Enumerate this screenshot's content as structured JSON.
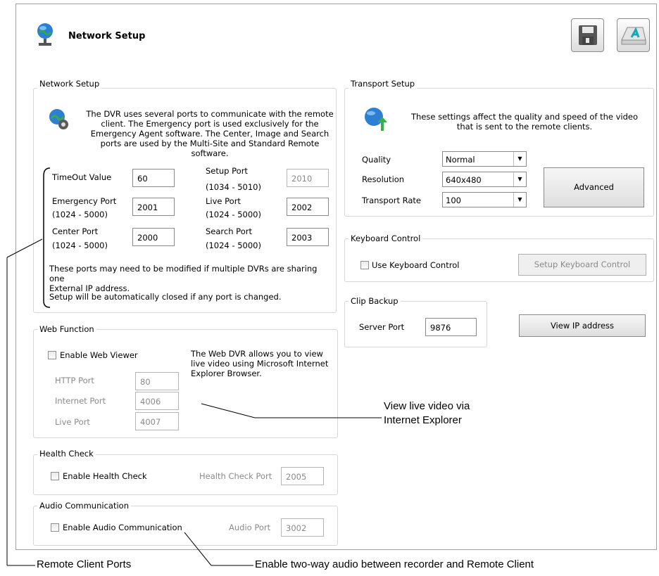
{
  "header": {
    "title": "Network Setup",
    "save_icon": "floppy-disk-icon",
    "exit_icon": "keyboard-key-icon"
  },
  "network_setup": {
    "label": "Network Setup",
    "description": [
      "The DVR uses several ports to communicate with the remote",
      "client. The Emergency port is used exclusively for the",
      "Emergency Agent software. The Center, Image and Search",
      "ports are used by the Multi-Site and Standard Remote",
      "software."
    ],
    "timeout_label": "TimeOut Value",
    "timeout_value": "60",
    "setup_port_label": "Setup Port",
    "setup_port_range": "(1034 - 5010)",
    "setup_port_value": "2010",
    "emergency_port_label": "Emergency Port",
    "emergency_port_range": "(1024 - 5000)",
    "emergency_port_value": "2001",
    "live_port_label": "Live Port",
    "live_port_range": "(1024 - 5000)",
    "live_port_value": "2002",
    "center_port_label": "Center Port",
    "center_port_range": "(1024 - 5000)",
    "center_port_value": "2000",
    "search_port_label": "Search Port",
    "search_port_range": "(1024 - 5000)",
    "search_port_value": "2003",
    "note1": [
      "These ports may need to be modified if multiple DVRs are sharing one",
      "External IP address."
    ],
    "note2": "Setup will be automatically closed if any port is changed."
  },
  "transport_setup": {
    "label": "Transport Setup",
    "description": [
      "These settings affect the quality and speed of the video",
      "that is sent to the remote clients."
    ],
    "quality_label": "Quality",
    "quality_value": "Normal",
    "resolution_label": "Resolution",
    "resolution_value": "640x480",
    "rate_label": "Transport Rate",
    "rate_value": "100",
    "advanced_button": "Advanced"
  },
  "keyboard_control": {
    "label": "Keyboard Control",
    "checkbox_label": "Use Keyboard Control",
    "setup_button": "Setup Keyboard Control"
  },
  "clip_backup": {
    "label": "Clip Backup",
    "server_port_label": "Server Port",
    "server_port_value": "9876",
    "view_ip_button": "View IP address"
  },
  "web_function": {
    "label": "Web Function",
    "checkbox_label": "Enable Web Viewer",
    "description": [
      "The Web DVR allows you to view",
      "live video using Microsoft Internet",
      "Explorer Browser."
    ],
    "http_label": "HTTP Port",
    "http_value": "80",
    "internet_label": "Internet Port",
    "internet_value": "4006",
    "live_label": "Live Port",
    "live_value": "4007"
  },
  "health_check": {
    "label": "Health Check",
    "checkbox_label": "Enable Health Check",
    "port_label": "Health Check Port",
    "port_value": "2005"
  },
  "audio": {
    "label": "Audio Communication",
    "checkbox_label": "Enable Audio Communication",
    "port_label": "Audio Port",
    "port_value": "3002"
  },
  "annotations": {
    "web": [
      "View live video via",
      "Internet Explorer"
    ],
    "ports": "Remote Client Ports",
    "audio": "Enable two-way audio between recorder and Remote Client"
  }
}
